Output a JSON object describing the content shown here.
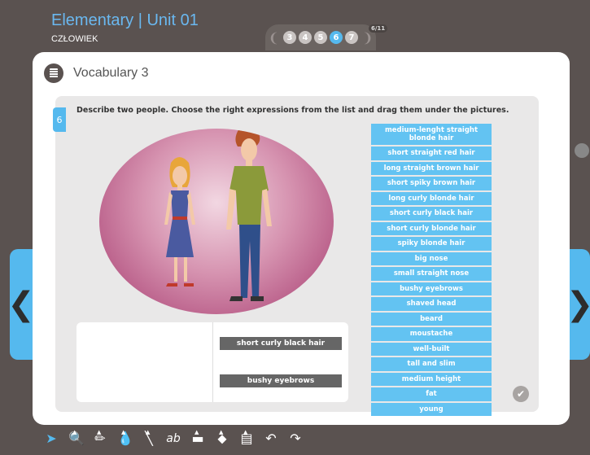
{
  "header": {
    "course_title": "Elementary | Unit 01",
    "course_subtitle": "CZŁOWIEK",
    "pages": [
      "3",
      "4",
      "5",
      "6",
      "7"
    ],
    "active_page": "6",
    "page_count": "6/11"
  },
  "card": {
    "title": "Vocabulary 3"
  },
  "exercise": {
    "number": "6",
    "instruction": "Describe two people. Choose the right expressions from the list and drag them under the pictures.",
    "dropped": [
      "short curly black hair",
      "bushy eyebrows"
    ],
    "expressions": [
      "medium-lenght straight blonde hair",
      "short straight red hair",
      "long straight brown hair",
      "short spiky brown hair",
      "long curly blonde hair",
      "short curly black hair",
      "short curly blonde hair",
      "spiky blonde hair",
      "big nose",
      "small straight nose",
      "bushy eyebrows",
      "shaved head",
      "beard",
      "moustache",
      "well-built",
      "tall and slim",
      "medium height",
      "fat",
      "young"
    ]
  },
  "nav": {
    "prev_glyph": "❮",
    "next_glyph": "❯",
    "check_glyph": "✔"
  },
  "toolbar": {
    "tools": [
      {
        "icon": "pointer-icon",
        "glyph": "➤"
      },
      {
        "icon": "zoom-icon",
        "glyph": "🔍"
      },
      {
        "icon": "pencil-icon",
        "glyph": "✏"
      },
      {
        "icon": "ink-drop-icon",
        "glyph": "💧"
      },
      {
        "icon": "line-icon",
        "glyph": "╲"
      },
      {
        "icon": "text-tool-icon",
        "glyph": "ab"
      },
      {
        "icon": "rectangle-icon",
        "glyph": "▬"
      },
      {
        "icon": "eraser-icon",
        "glyph": "⬥"
      },
      {
        "icon": "notes-icon",
        "glyph": "▤"
      },
      {
        "icon": "undo-icon",
        "glyph": "↶"
      },
      {
        "icon": "redo-icon",
        "glyph": "↷"
      }
    ]
  },
  "colors": {
    "accent": "#55b9ee",
    "background": "#5a5250",
    "expression_bg": "#63c3f2",
    "dropped_bg": "#666666"
  }
}
